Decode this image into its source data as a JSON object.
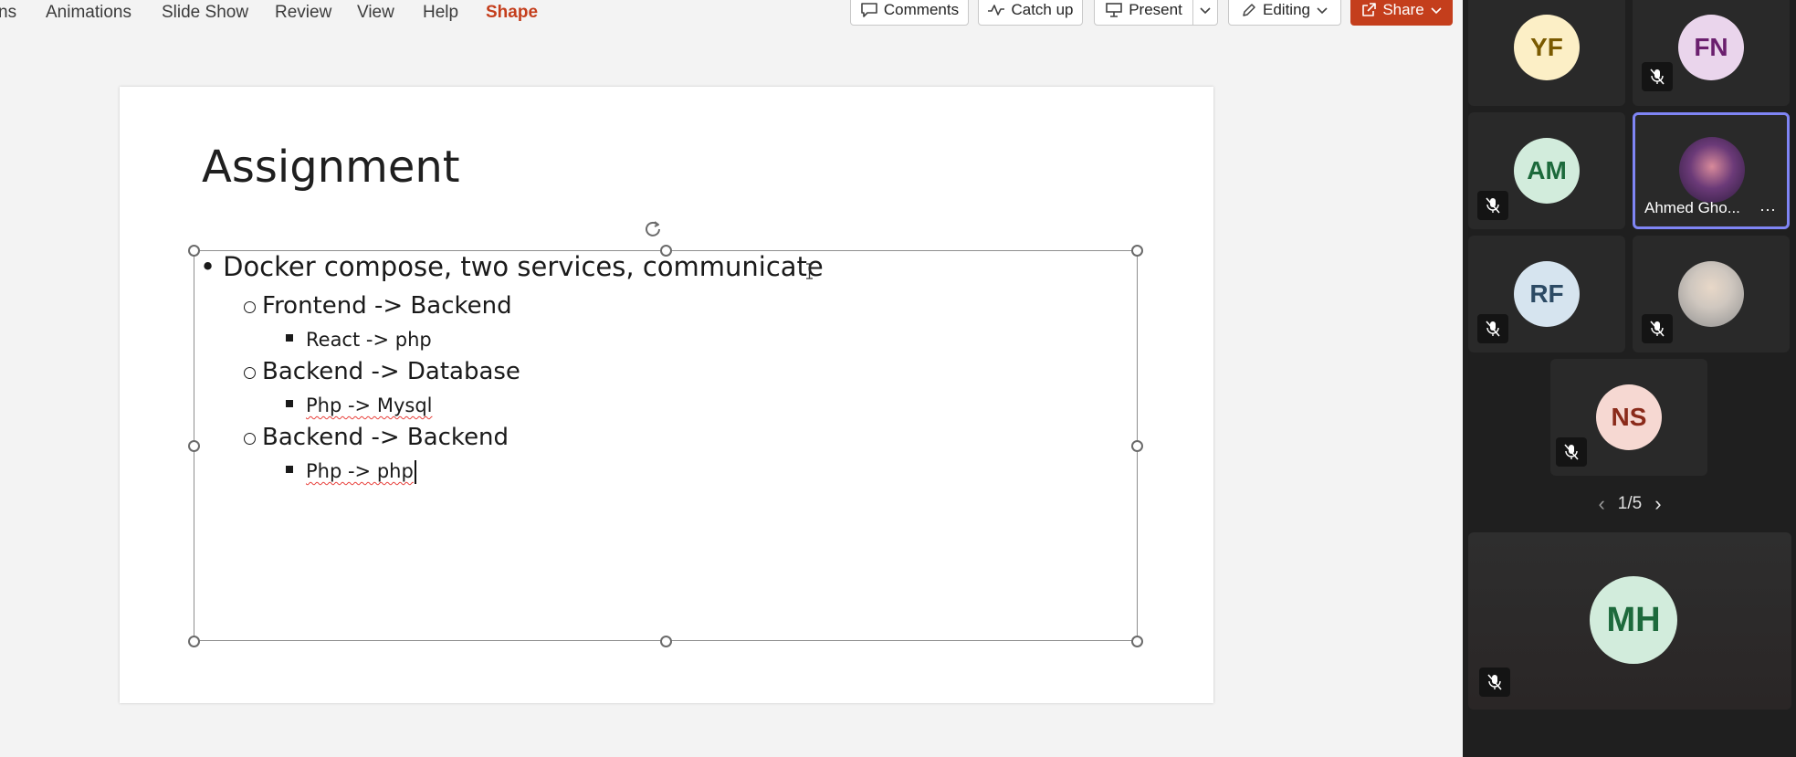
{
  "ribbon": {
    "tabs": [
      {
        "label": "ns"
      },
      {
        "label": "Animations"
      },
      {
        "label": "Slide Show"
      },
      {
        "label": "Review"
      },
      {
        "label": "View"
      },
      {
        "label": "Help"
      },
      {
        "label": "Shape"
      }
    ],
    "active_tab": "Shape",
    "buttons": {
      "comments": "Comments",
      "catch_up": "Catch up",
      "present": "Present",
      "editing": "Editing",
      "share": "Share"
    }
  },
  "slide": {
    "title": "Assignment",
    "bullets": [
      {
        "level": 1,
        "text": "Docker compose, two services, communicate"
      },
      {
        "level": 2,
        "text": "Frontend -> Backend"
      },
      {
        "level": 3,
        "text": "React -> php"
      },
      {
        "level": 2,
        "text": "Backend -> Database"
      },
      {
        "level": 3,
        "text": "Php -> Mysql"
      },
      {
        "level": 2,
        "text": "Backend -> Backend"
      },
      {
        "level": 3,
        "text": "Php -> php"
      }
    ]
  },
  "meeting": {
    "participants": [
      {
        "initials": "YF",
        "muted": false,
        "bg": "#fcefc6",
        "fg": "#7a5a00"
      },
      {
        "initials": "FN",
        "muted": true,
        "bg": "#ead5ec",
        "fg": "#6b1f6e"
      },
      {
        "initials": "AM",
        "muted": true,
        "bg": "#d2ecdc",
        "fg": "#1d6a3c"
      },
      {
        "name": "Ahmed Gho...",
        "muted": false,
        "speaking": true,
        "photo": true
      },
      {
        "initials": "RF",
        "muted": true,
        "bg": "#d6e4ef",
        "fg": "#2c4a64"
      },
      {
        "muted": true,
        "photo": true
      },
      {
        "initials": "NS",
        "muted": true,
        "bg": "#f6d8d2",
        "fg": "#8a2a1a"
      }
    ],
    "pager": "1/5",
    "self": {
      "initials": "MH",
      "muted": true,
      "bg": "#d2ecdc",
      "fg": "#1d6a3c"
    },
    "colors": {
      "panel_bg": "#1f1f1f",
      "tile_bg": "#292929",
      "speaking_border": "#7f85f5",
      "share_bg": "#c43e1c"
    }
  }
}
